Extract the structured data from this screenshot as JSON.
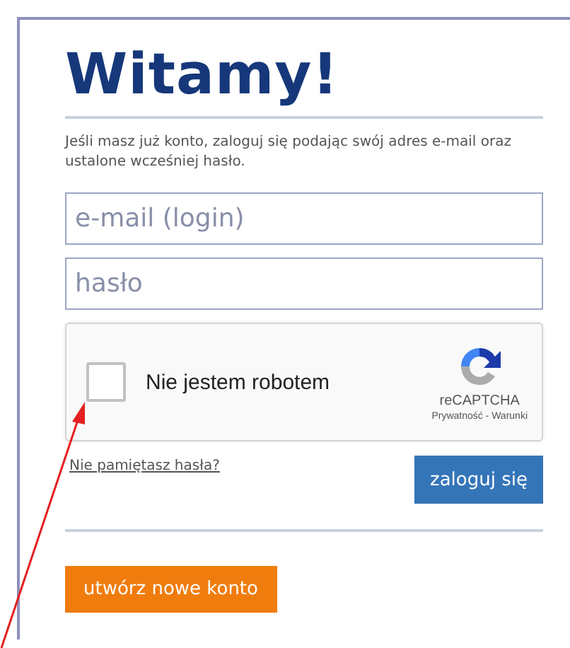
{
  "title": "Witamy!",
  "intro": "Jeśli masz już konto, zaloguj się podając swój adres e-mail oraz ustalone wcześniej hasło.",
  "fields": [
    {
      "placeholder": "e-mail (login)"
    },
    {
      "placeholder": "hasło"
    }
  ],
  "captcha": {
    "label": "Nie jestem robotem",
    "checked": false,
    "brand": "reCAPTCHA",
    "links": "Prywatność - Warunki"
  },
  "forgot_link": "Nie pamiętasz hasła?",
  "login_button": "zaloguj się",
  "register_button": "utwórz nowe konto"
}
